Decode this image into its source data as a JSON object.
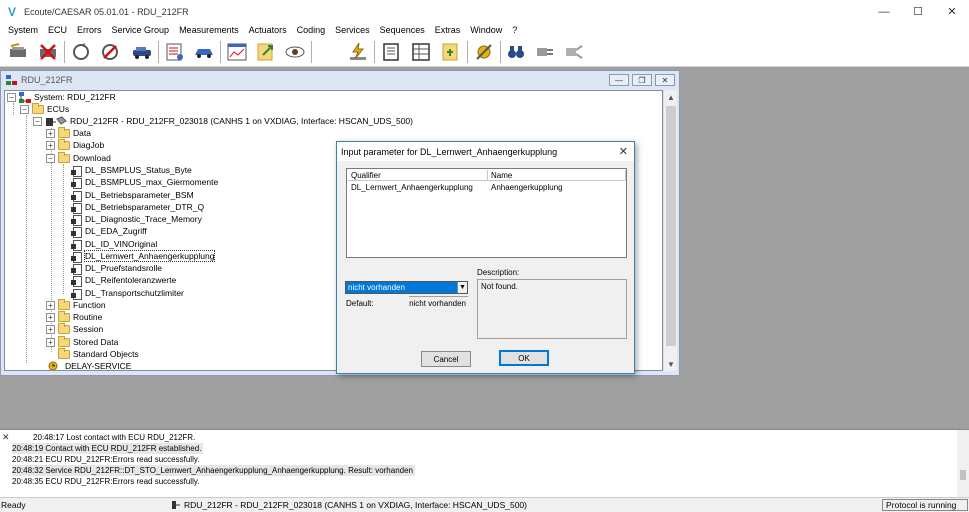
{
  "window": {
    "title": "Ecoute/CAESAR 05.01.01 - RDU_212FR",
    "logo_glyph": "V"
  },
  "menu": [
    "System",
    "ECU",
    "Errors",
    "Service Group",
    "Measurements",
    "Actuators",
    "Coding",
    "Services",
    "Sequences",
    "Extras",
    "Window",
    "?"
  ],
  "toolbar": {
    "buttons": [
      "connect-icon",
      "disconnect-icon",
      "refresh-icon",
      "stop-diagnostics-icon",
      "vehicle-icon",
      "measurement-icon",
      "car-icon",
      "graph-icon",
      "export-icon",
      "eye-icon",
      "flash-icon",
      "list-view-icon",
      "table-view-icon",
      "import-icon",
      "settings-icon",
      "binoculars-icon",
      "plug-icon",
      "unplug-icon"
    ]
  },
  "child_window": {
    "title": "RDU_212FR",
    "tree": {
      "system": "System: RDU_212FR",
      "ecus": "ECUs",
      "ecu_node": "RDU_212FR - RDU_212FR_023018 (CANHS 1 on VXDIAG, Interface: HSCAN_UDS_500)",
      "folders_top": [
        "Data",
        "DiagJob"
      ],
      "download": "Download",
      "download_items": [
        "DL_BSMPLUS_Status_Byte",
        "DL_BSMPLUS_max_Giermomente",
        "DL_Betriebsparameter_BSM",
        "DL_Betriebsparameter_DTR_Q",
        "DL_Diagnostic_Trace_Memory",
        "DL_EDA_Zugriff",
        "DL_ID_VINOriginal",
        "DL_Lernwert_Anhaengerkupplung",
        "DL_Pruefstandsrolle",
        "DL_Reifentoleranzwerte",
        "DL_Transportschutzlimiter"
      ],
      "folders_bottom": [
        "Function",
        "Routine",
        "Session",
        "Stored Data",
        "Standard Objects"
      ],
      "delay": "DELAY-SERVICE"
    }
  },
  "dialog": {
    "title": "Input parameter for DL_Lernwert_Anhaengerkupplung",
    "columns": [
      "Qualifier",
      "Name"
    ],
    "rows": [
      {
        "qualifier": "DL_Lernwert_Anhaengerkupplung",
        "name": "Anhaengerkupplung"
      }
    ],
    "combo_value": "nicht vorhanden",
    "default_label": "Default:",
    "default_value": "nicht vorhanden",
    "description_label": "Description:",
    "description": "Not found.",
    "cancel": "Cancel",
    "ok": "OK"
  },
  "log": [
    "20:48:17 Lost contact with ECU RDU_212FR.",
    "20:48:19 Contact with ECU RDU_212FR established.",
    "20:48:21 ECU RDU_212FR:Errors read successfully.",
    "20:48:32 Service RDU_212FR::DT_STO_Lernwert_Anhaengerkupplung_Anhaengerkupplung. Result: vorhanden",
    "20:48:35 ECU RDU_212FR:Errors read successfully."
  ],
  "status": {
    "ready": "Ready",
    "ecu": "RDU_212FR - RDU_212FR_023018 (CANHS 1 on VXDIAG, Interface: HSCAN_UDS_500)",
    "protocol": "Protocol is running"
  }
}
